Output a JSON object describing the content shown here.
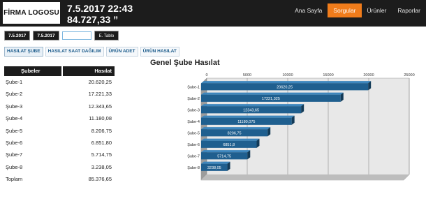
{
  "header": {
    "logo": "FİRMA LOGOSU",
    "datetime": "7.5.2017 22:43",
    "total": "84.727,33 ”",
    "nav": [
      {
        "label": "Ana Sayfa",
        "active": false
      },
      {
        "label": "Sorgular",
        "active": true
      },
      {
        "label": "Ürünler",
        "active": false
      },
      {
        "label": "Raporlar",
        "active": false
      }
    ]
  },
  "filters": {
    "start_date": "7.5.2017",
    "end_date": "7.5.2017",
    "text_value": "",
    "button_label": "E. Tablo"
  },
  "tabs": [
    {
      "label": "HASILAT ŞUBE",
      "active": true
    },
    {
      "label": "HASILAT SAAT DAĞILIM",
      "active": false
    },
    {
      "label": "ÜRÜN ADET",
      "active": false
    },
    {
      "label": "ÜRÜN HASILAT",
      "active": false
    }
  ],
  "table": {
    "headers": [
      "Şubeler",
      "Hasılat"
    ],
    "rows": [
      {
        "name": "Şube-1",
        "value": "20.620,25"
      },
      {
        "name": "Şube-2",
        "value": "17.221,33"
      },
      {
        "name": "Şube-3",
        "value": "12.343,65"
      },
      {
        "name": "Şube-4",
        "value": "11.180,08"
      },
      {
        "name": "Şube-5",
        "value": "8.206,75"
      },
      {
        "name": "Şube-6",
        "value": "6.851,80"
      },
      {
        "name": "Şube-7",
        "value": "5.714,75"
      },
      {
        "name": "Şube-8",
        "value": "3.238,05"
      },
      {
        "name": "Toplam",
        "value": "85.376,65"
      }
    ]
  },
  "chart_data": {
    "type": "bar",
    "orientation": "horizontal",
    "title": "Genel Şube Hasılat",
    "categories": [
      "Şube-1",
      "Şube-2",
      "Şube-3",
      "Şube-4",
      "Şube-5",
      "Şube-6",
      "Şube-7",
      "Şube-8"
    ],
    "values": [
      20620.25,
      17221.325,
      12343.65,
      11180.075,
      8206.75,
      6851.8,
      5714.75,
      3238.05
    ],
    "value_labels": [
      "20620,25",
      "17221,325",
      "12343,65",
      "11180,075",
      "8206,75",
      "6851,8",
      "5714,75",
      "3238,05"
    ],
    "xticks": [
      "0",
      "5000",
      "10000",
      "15000",
      "20000",
      "25000"
    ],
    "xlim": [
      0,
      25000
    ],
    "grid": true,
    "bar_color": "#1f5f8f"
  }
}
